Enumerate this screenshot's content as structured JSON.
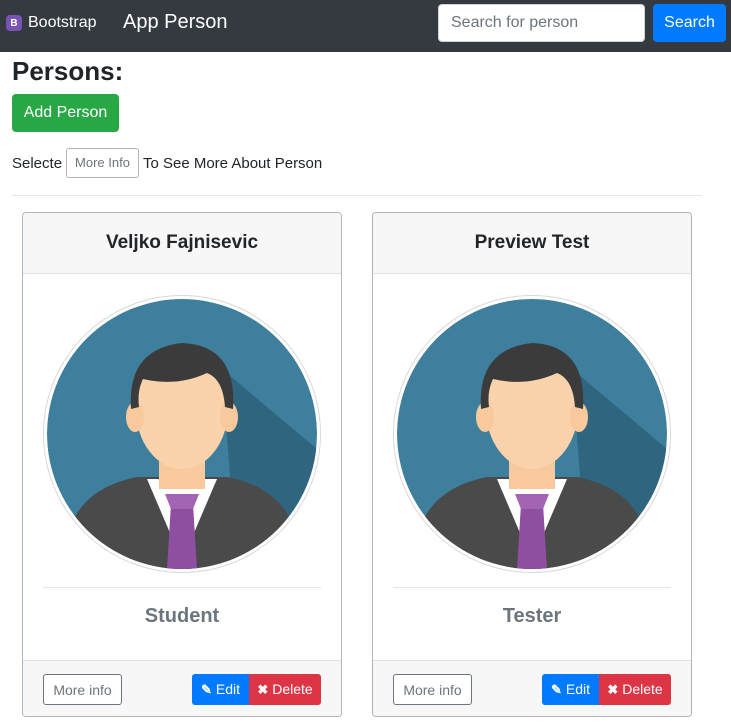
{
  "navbar": {
    "brand_icon": "B",
    "brand": "Bootstrap",
    "title": "App Person",
    "search_placeholder": "Search for person",
    "search_button": "Search"
  },
  "page": {
    "heading": "Persons:",
    "add_button": "Add Person",
    "hint_before": "Selecte",
    "hint_chip": "More Info",
    "hint_after": "To See More About Person"
  },
  "persons": [
    {
      "name": "Veljko Fajnisevic",
      "role": "Student",
      "more_label": "More info",
      "edit_label": "Edit",
      "delete_label": "Delete"
    },
    {
      "name": "Preview Test",
      "role": "Tester",
      "more_label": "More info",
      "edit_label": "Edit",
      "delete_label": "Delete"
    }
  ],
  "icons": {
    "edit": "pencil-icon",
    "delete": "times-icon",
    "avatar": "person-avatar-icon"
  },
  "colors": {
    "primary": "#007bff",
    "success": "#28a745",
    "danger": "#dc3545",
    "navbar": "#343a40",
    "avatar_bg": "#3e7f9e"
  }
}
